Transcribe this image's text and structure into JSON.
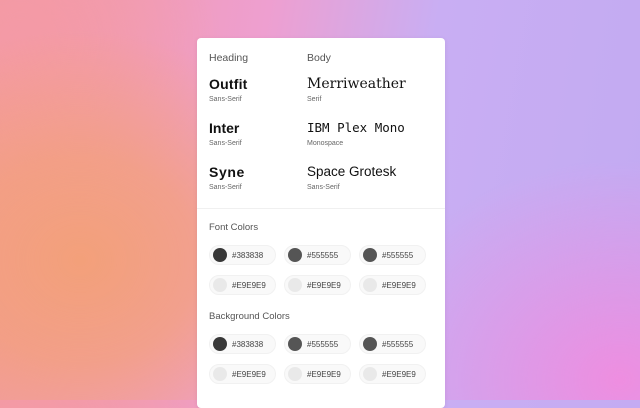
{
  "colors": {
    "c1": "#383838",
    "c2": "#555555",
    "c3": "#E9E9E9"
  },
  "panel": {
    "heading_col_label": "Heading",
    "body_col_label": "Body",
    "fonts": [
      {
        "name": "Outfit",
        "category": "Sans-Serif"
      },
      {
        "name": "Merriweather",
        "category": "Serif"
      },
      {
        "name": "Inter",
        "category": "Sans-Serif"
      },
      {
        "name": "IBM Plex Mono",
        "category": "Monospace"
      },
      {
        "name": "Syne",
        "category": "Sans-Serif"
      },
      {
        "name": "Space Grotesk",
        "category": "Sans-Serif"
      }
    ],
    "font_colors_title": "Font Colors",
    "font_colors": [
      "#383838",
      "#555555",
      "#555555",
      "#E9E9E9",
      "#E9E9E9",
      "#E9E9E9"
    ],
    "background_colors_title": "Background Colors",
    "background_colors": [
      "#383838",
      "#555555",
      "#555555",
      "#E9E9E9",
      "#E9E9E9",
      "#E9E9E9"
    ]
  }
}
